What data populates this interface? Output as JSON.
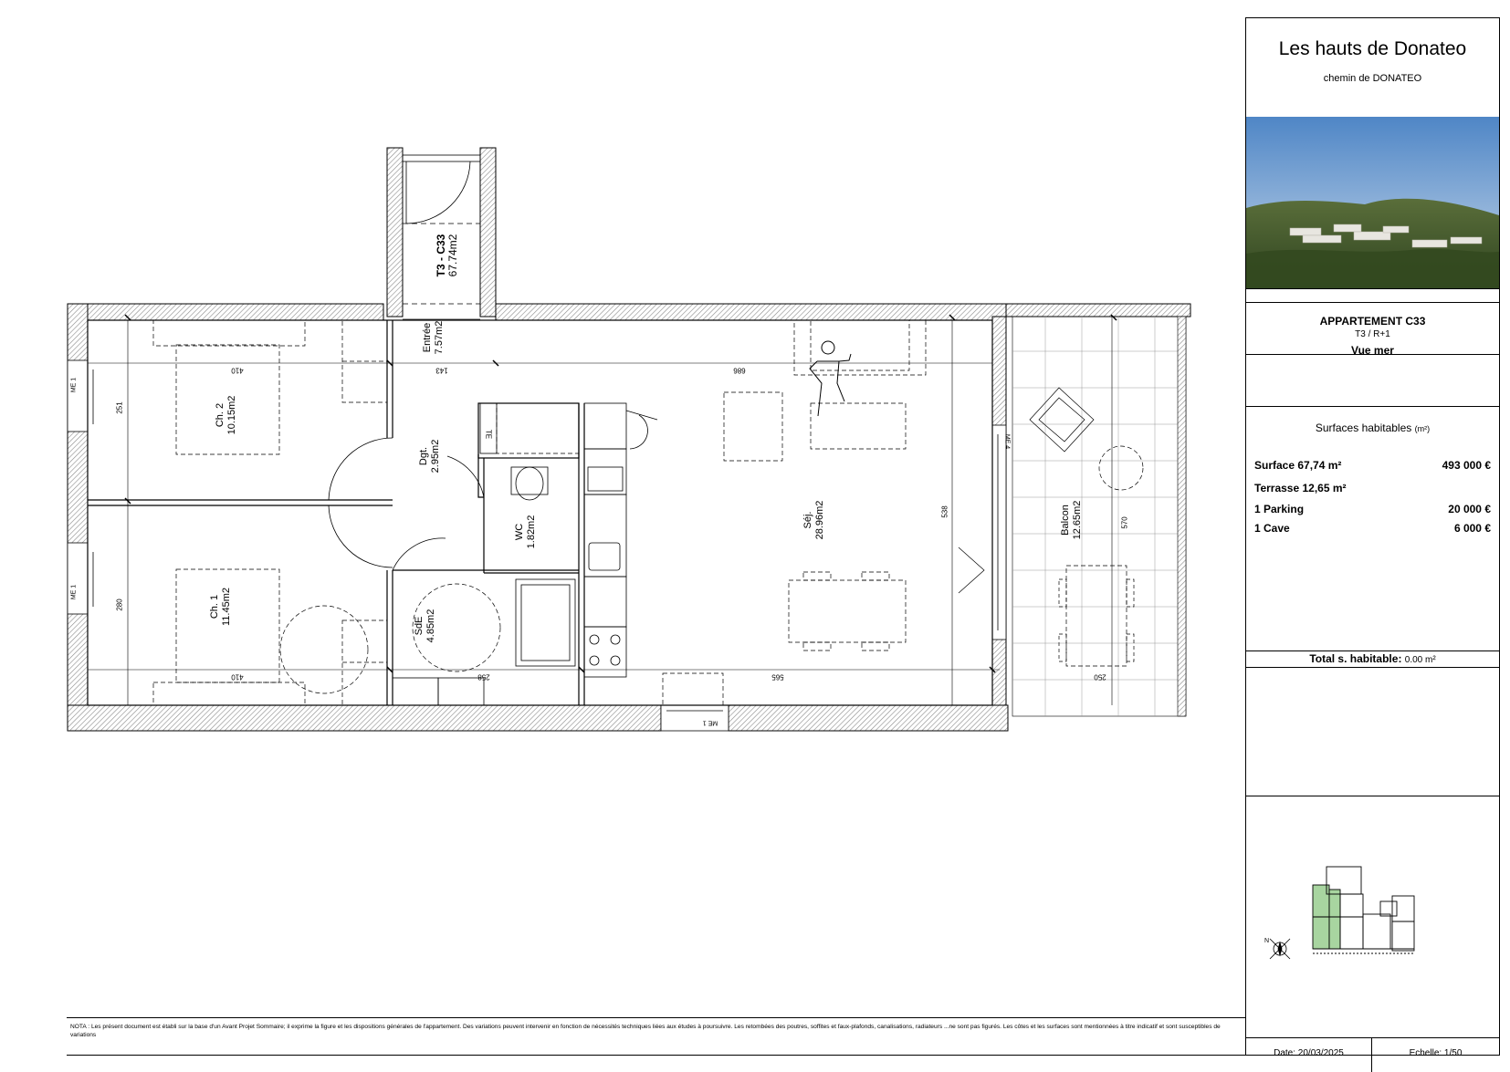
{
  "project": {
    "title": "Les hauts de Donateo",
    "subtitle": "chemin de DONATEO"
  },
  "apartment": {
    "title": "APPARTEMENT C33",
    "type_level": "T3 / R+1",
    "view": "Vue mer"
  },
  "plan_tag": {
    "code": "T3 - C33",
    "area": "67.74m2"
  },
  "rooms": {
    "entree": {
      "name": "Entrée",
      "area": "7.57m2"
    },
    "dgt": {
      "name": "Dgt.",
      "area": "2.95m2"
    },
    "ch2": {
      "name": "Ch. 2",
      "area": "10.15m2"
    },
    "ch1": {
      "name": "Ch. 1",
      "area": "11.45m2"
    },
    "wc": {
      "name": "WC",
      "area": "1.82m2"
    },
    "sde": {
      "name": "SdE",
      "area": "4.85m2"
    },
    "sejour": {
      "name": "Séj.",
      "area": "28.96m2"
    },
    "balcon": {
      "name": "Balcon",
      "area": "12.65m2"
    }
  },
  "dimensions": {
    "ch2_width": "410",
    "ch1_width": "410",
    "entree_width": "143",
    "sejour_width": "686",
    "bottom_sejour": "565",
    "bottom_sde": "258",
    "ch2_depth": "251",
    "ch1_depth": "280",
    "sejour_depth": "538",
    "balcon_depth": "570",
    "balcon_width": "250"
  },
  "windows": {
    "me1_ch2": "ME 1",
    "me1_ch1": "ME 1",
    "me1_sejour": "ME 1",
    "me4": "ME 4"
  },
  "fixtures": {
    "te": "TE"
  },
  "surfaces": {
    "title": "Surfaces habitables",
    "unit": "(m²)",
    "surface_label": "Surface 67,74 m²",
    "surface_price": "493 000 €",
    "terrasse_label": "Terrasse 12,65 m²",
    "parking_label": "1 Parking",
    "parking_price": "20 000 €",
    "cave_label": "1 Cave",
    "cave_price": "6 000 €",
    "total_label": "Total s. habitable:",
    "total_value": "0.00 m²"
  },
  "footer": {
    "nota": "NOTA : Les présent document est établi sur la base d'un Avant Projet Sommaire; il exprime la figure et les dispositions générales de l'appartement. Des variations peuvent intervenir en fonction de nécessités techniques liées aux études à poursuivre. Les retombées des poutres, soffites et faux-plafonds, canalisations, radiateurs ...ne sont pas figurés. Les côtes et les surfaces sont mentionnées à titre indicatif et sont susceptibles de variations",
    "date": "Date: 20/03/2025",
    "scale": "Echelle: 1/50"
  },
  "colors": {
    "wall_hatch": "#9a9a9a",
    "keyplan_highlight": "#a8d5a0",
    "sky": "#6e9fd0",
    "vegetation": "#3c5426"
  }
}
